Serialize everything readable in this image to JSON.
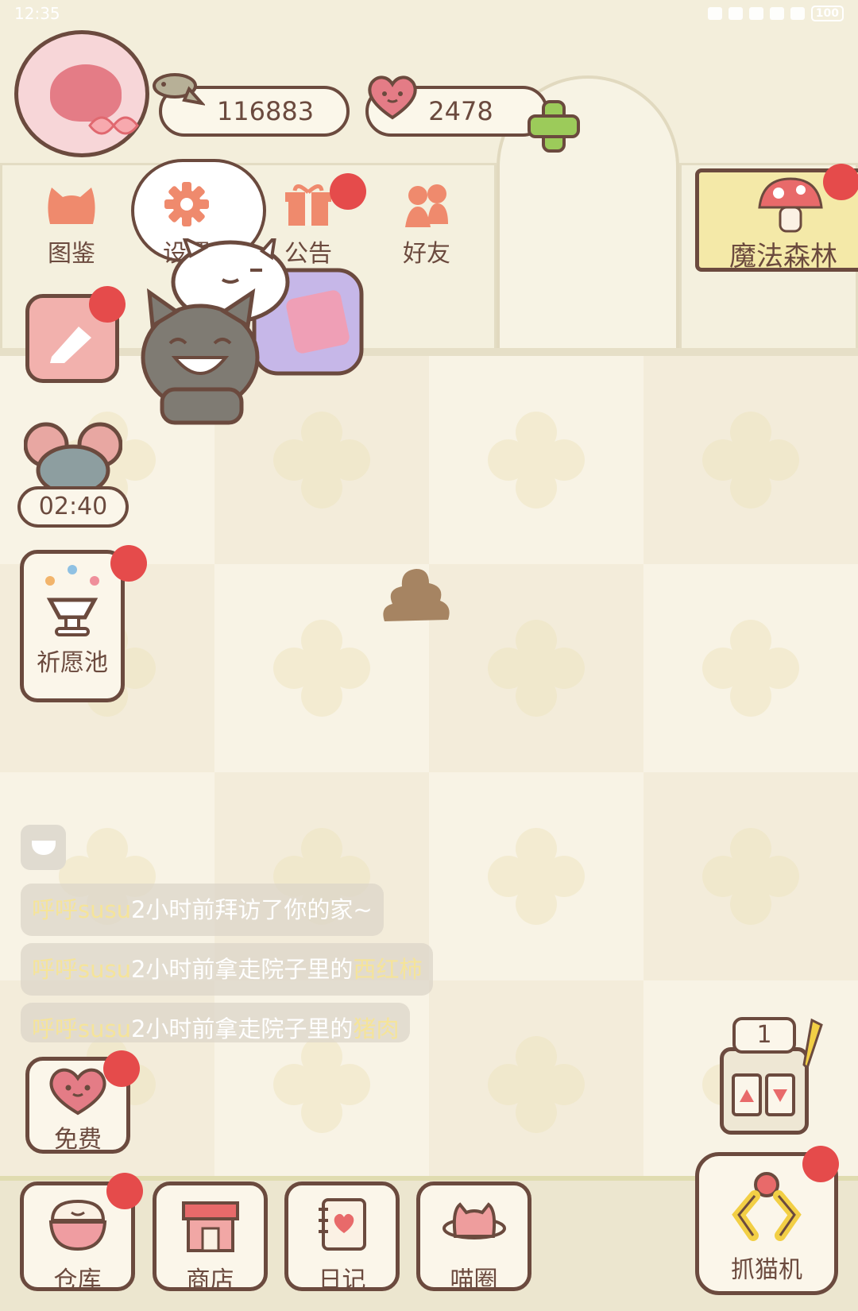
{
  "status_bar": {
    "time": "12:35",
    "battery": "100"
  },
  "currency": {
    "fish_coins": "116883",
    "hearts": "2478"
  },
  "nav": {
    "catalog": "图鉴",
    "settings": "设置",
    "notice": "公告",
    "friends": "好友"
  },
  "magic_forest": {
    "label": "魔法森林"
  },
  "timer": {
    "value": "02:40"
  },
  "wishing_well": {
    "label": "祈愿池"
  },
  "chat": {
    "messages": [
      {
        "user": "呼呼susu",
        "text": "2小时前拜访了你的家~",
        "item": ""
      },
      {
        "user": "呼呼susu",
        "text": "2小时前拿走院子里的",
        "item": "西红柿"
      },
      {
        "user": "呼呼susu",
        "text": "2小时前拿走院子里的",
        "item": "猪肉"
      }
    ]
  },
  "free": {
    "label": "免费"
  },
  "slot_machine": {
    "count": "1"
  },
  "bottom_bar": {
    "warehouse": "仓库",
    "shop": "商店",
    "diary": "日记",
    "cat_circle": "喵圈"
  },
  "catch_cat": {
    "label": "抓猫机"
  },
  "colors": {
    "outline": "#6b4a3e",
    "notification": "#e54b4b",
    "accent_pink": "#e47c86",
    "accent_green": "#9ccb5a",
    "highlight_text": "#f5e49a"
  },
  "icons": [
    "fish-icon",
    "heart-icon",
    "plus-icon",
    "cat-head-icon",
    "gear-icon",
    "gift-icon",
    "friends-icon",
    "calendar-icon",
    "mouse-icon",
    "fountain-icon",
    "mushroom-icon",
    "chat-icon",
    "heart-face-icon",
    "slot-machine-icon",
    "rice-bowl-icon",
    "shop-icon",
    "diary-icon",
    "planet-cat-icon",
    "claw-icon",
    "poop-icon"
  ]
}
